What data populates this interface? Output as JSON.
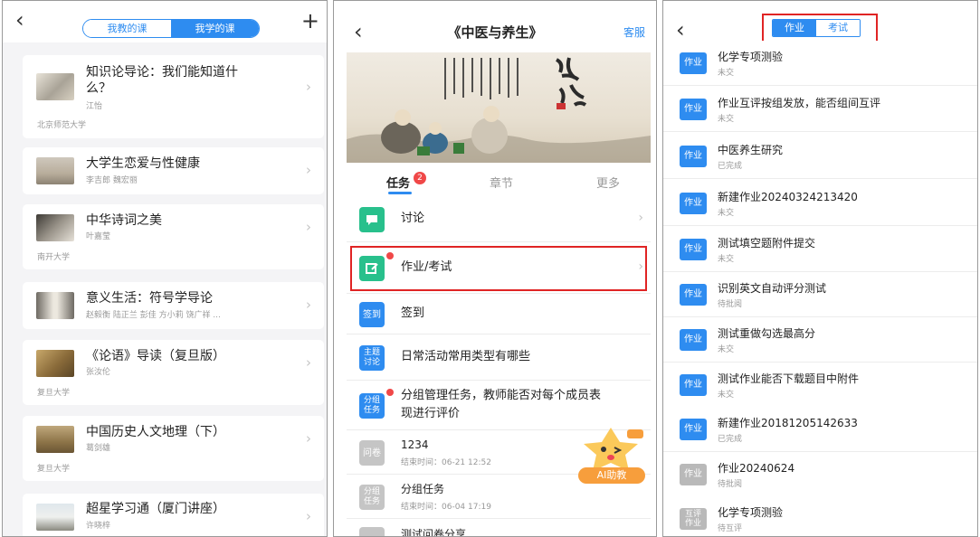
{
  "panel1": {
    "segment": [
      "我教的课",
      "我学的课"
    ],
    "courses": [
      {
        "title_l1": "知识论导论：我们能知道什",
        "title_l2": "么？",
        "teacher": "江怡",
        "school": "北京师范大学"
      },
      {
        "title_l1": "大学生恋爱与性健康",
        "teacher": "李吉郎 魏宏丽"
      },
      {
        "title_l1": "中华诗词之美",
        "teacher": "叶嘉莹",
        "school": "南开大学"
      },
      {
        "title_l1": "意义生活：符号学导论",
        "teacher": "赵毅衡 陆正兰 彭佳 方小莉 饶广祥 ..."
      },
      {
        "title_l1": "《论语》导读（复旦版）",
        "teacher": "张汝伦",
        "school": "复旦大学"
      },
      {
        "title_l1": "中国历史人文地理（下）",
        "teacher": "葛剑雄",
        "school": "复旦大学"
      },
      {
        "title_l1": "超星学习通（厦门讲座）",
        "teacher": "许晓梓"
      }
    ]
  },
  "panel2": {
    "title": "《中医与养生》",
    "service": "客服",
    "tabs": [
      "任务",
      "章节",
      "更多"
    ],
    "badge_count": "2",
    "tasks": [
      {
        "icon_text": "",
        "label": "讨论"
      },
      {
        "icon_text": "",
        "label": "作业/考试"
      },
      {
        "icon_text": "签到",
        "label": "签到"
      },
      {
        "icon_text": "主题\n讨论",
        "label": "日常活动常用类型有哪些"
      },
      {
        "icon_text": "分组\n任务",
        "label": "分组管理任务，教师能否对每个成员表",
        "label2": "现进行评价"
      },
      {
        "icon_text": "问卷",
        "label": "1234",
        "sub": "结束时间：06-21 12:52"
      },
      {
        "icon_text": "分组\n任务",
        "label": "分组任务",
        "sub": "结束时间：06-04 17:19"
      },
      {
        "icon_text": "",
        "label": "测试问卷分享"
      }
    ],
    "ai_helper": "AI助教"
  },
  "panel3": {
    "segment": [
      "作业",
      "考试"
    ],
    "items": [
      {
        "badge": "作业",
        "title": "化学专项测验",
        "status": "未交",
        "gray": false
      },
      {
        "badge": "作业",
        "title": "作业互评按组发放，能否组间互评",
        "status": "未交",
        "gray": false
      },
      {
        "badge": "作业",
        "title": "中医养生研究",
        "status": "已完成",
        "gray": false
      },
      {
        "badge": "作业",
        "title": "新建作业20240324213420",
        "status": "未交",
        "gray": false
      },
      {
        "badge": "作业",
        "title": "测试填空题附件提交",
        "status": "未交",
        "gray": false
      },
      {
        "badge": "作业",
        "title": "识别英文自动评分测试",
        "status": "待批阅",
        "gray": false
      },
      {
        "badge": "作业",
        "title": "测试重做勾选最高分",
        "status": "未交",
        "gray": false
      },
      {
        "badge": "作业",
        "title": "测试作业能否下载题目中附件",
        "status": "未交",
        "gray": false
      },
      {
        "badge": "作业",
        "title": "新建作业20181205142633",
        "status": "已完成",
        "gray": false
      },
      {
        "badge": "作业",
        "title": "作业20240624",
        "status": "待批阅",
        "gray": true
      },
      {
        "badge": "互评\n作业",
        "title": "化学专项测验",
        "status": "待互评",
        "gray": true
      }
    ]
  },
  "colors": {
    "accent": "#2e8cf0",
    "highlight": "#e02424",
    "red_dot": "#f04848",
    "ai_orange": "#f79e3c"
  }
}
